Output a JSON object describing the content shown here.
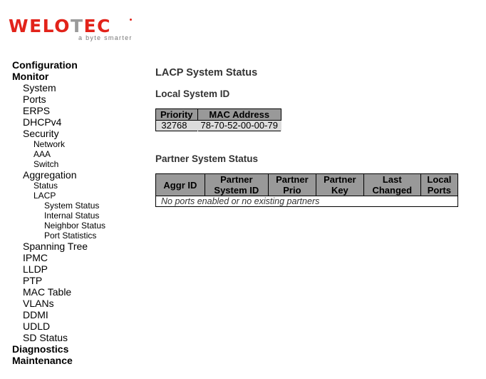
{
  "logo": {
    "brand_red": "WELO",
    "brand_grey": "T",
    "brand_red2": "EC",
    "tagline": "a byte smarter",
    "brand_color": "#e2231a"
  },
  "menu": {
    "configuration": "Configuration",
    "monitor": "Monitor",
    "monitor_items": {
      "system": "System",
      "ports": "Ports",
      "erps": "ERPS",
      "dhcpv4": "DHCPv4",
      "security": "Security",
      "security_items": [
        "Network",
        "AAA",
        "Switch"
      ],
      "aggregation": "Aggregation",
      "aggregation_status": "Status",
      "lacp": "LACP",
      "lacp_items": [
        "System Status",
        "Internal Status",
        "Neighbor Status",
        "Port Statistics"
      ],
      "spanning_tree": "Spanning Tree",
      "ipmc": "IPMC",
      "lldp": "LLDP",
      "ptp": "PTP",
      "mac_table": "MAC Table",
      "vlans": "VLANs",
      "ddmi": "DDMI",
      "udld": "UDLD",
      "sd_status": "SD Status"
    },
    "diagnostics": "Diagnostics",
    "maintenance": "Maintenance"
  },
  "page": {
    "title": "LACP System Status",
    "local_section": "Local System ID",
    "local_table": {
      "headers": [
        "Priority",
        "MAC Address"
      ],
      "row": {
        "priority": "32768",
        "mac": "78-70-52-00-00-79"
      }
    },
    "partner_section": "Partner System Status",
    "partner_table": {
      "headers": [
        [
          "Aggr ID"
        ],
        [
          "Partner",
          "System ID"
        ],
        [
          "Partner",
          "Prio"
        ],
        [
          "Partner",
          "Key"
        ],
        [
          "Last",
          "Changed"
        ],
        [
          "Local",
          "Ports"
        ]
      ],
      "empty_message": "No ports enabled or no existing partners"
    }
  }
}
